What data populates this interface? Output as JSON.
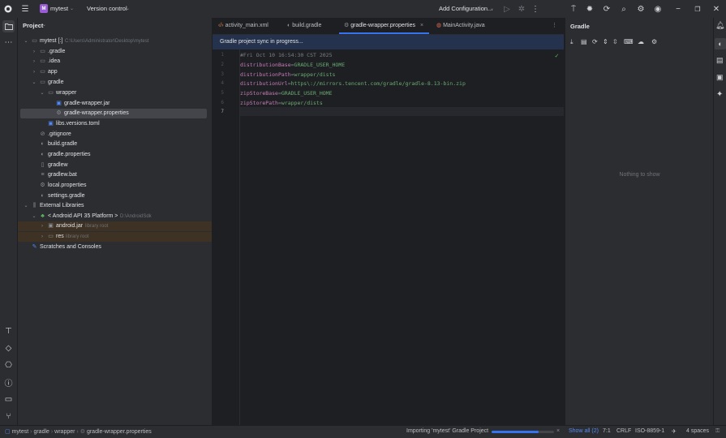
{
  "titlebar": {
    "project_badge": "M",
    "project_name": "mytest",
    "vcs": "Version control",
    "run_config": "Add Configuration..."
  },
  "project_panel": {
    "title": "Project",
    "tree": [
      {
        "label": "mytest [:]",
        "path": "C:\\Users\\Administrator\\Desktop\\mytest",
        "icon": "folder-icon"
      },
      {
        "label": ".gradle",
        "icon": "folder-icon"
      },
      {
        "label": ".idea",
        "icon": "folder-icon"
      },
      {
        "label": "app",
        "icon": "folder-icon"
      },
      {
        "label": "gradle",
        "icon": "folder-icon"
      },
      {
        "label": "wrapper",
        "icon": "folder-icon"
      },
      {
        "label": "gradle-wrapper.jar",
        "icon": "jar-icon"
      },
      {
        "label": "gradle-wrapper.properties",
        "icon": "gear-icon"
      },
      {
        "label": "libs.versions.toml",
        "icon": "toml-icon"
      },
      {
        "label": ".gitignore",
        "icon": "gitignore-icon"
      },
      {
        "label": "build.gradle",
        "icon": "gradle-icon"
      },
      {
        "label": "gradle.properties",
        "icon": "gradle-icon"
      },
      {
        "label": "gradlew",
        "icon": "file-icon"
      },
      {
        "label": "gradlew.bat",
        "icon": "file-icon"
      },
      {
        "label": "local.properties",
        "icon": "gear-icon"
      },
      {
        "label": "settings.gradle",
        "icon": "gradle-icon"
      },
      {
        "label": "External Libraries",
        "icon": "library-icon"
      },
      {
        "label": "< Android API 35 Platform >",
        "path": "D:\\AndroidSdk",
        "icon": "android-icon"
      },
      {
        "label": "android.jar",
        "path": "library root",
        "icon": "jar-icon"
      },
      {
        "label": "res",
        "path": "library root",
        "icon": "folder-icon"
      },
      {
        "label": "Scratches and Consoles",
        "icon": "scratch-icon"
      }
    ]
  },
  "editor": {
    "tabs": [
      {
        "label": "activity_main.xml",
        "icon": "xml-icon"
      },
      {
        "label": "build.gradle",
        "icon": "gradle-icon"
      },
      {
        "label": "gradle-wrapper.properties",
        "icon": "gear-icon",
        "active": true
      },
      {
        "label": "MainActivity.java",
        "icon": "java-icon"
      }
    ],
    "banner": "Gradle project sync in progress...",
    "line_numbers": [
      "1",
      "2",
      "3",
      "4",
      "5",
      "6",
      "7"
    ],
    "lines": [
      {
        "comment": "#Fri Oct 10 16:54:30 CST 2025"
      },
      {
        "key": "distributionBase",
        "eq": "=",
        "value": "GRADLE_USER_HOME"
      },
      {
        "key": "distributionPath",
        "eq": "=",
        "value": "wrapper/dists"
      },
      {
        "key": "distributionUrl",
        "eq": "=",
        "value": "https\\://mirrors.tencent.com/gradle/gradle-8.13-bin.zip"
      },
      {
        "key": "zipStoreBase",
        "eq": "=",
        "value": "GRADLE_USER_HOME"
      },
      {
        "key": "zipStorePath",
        "eq": "=",
        "value": "wrapper/dists"
      }
    ]
  },
  "gradle_panel": {
    "title": "Gradle",
    "empty": "Nothing to show"
  },
  "statusbar": {
    "breadcrumb": [
      "mytest",
      "gradle",
      "wrapper",
      "gradle-wrapper.properties"
    ],
    "task": "Importing 'mytest' Gradle Project",
    "progress": 0.75,
    "show_all": "Show all (2)",
    "position": "7:1",
    "line_sep": "CRLF",
    "encoding": "ISO-8859-1",
    "indent": "4 spaces"
  },
  "colors": {
    "accent": "#3574f0",
    "banner": "#25324d",
    "library_row": "#3d3223"
  }
}
